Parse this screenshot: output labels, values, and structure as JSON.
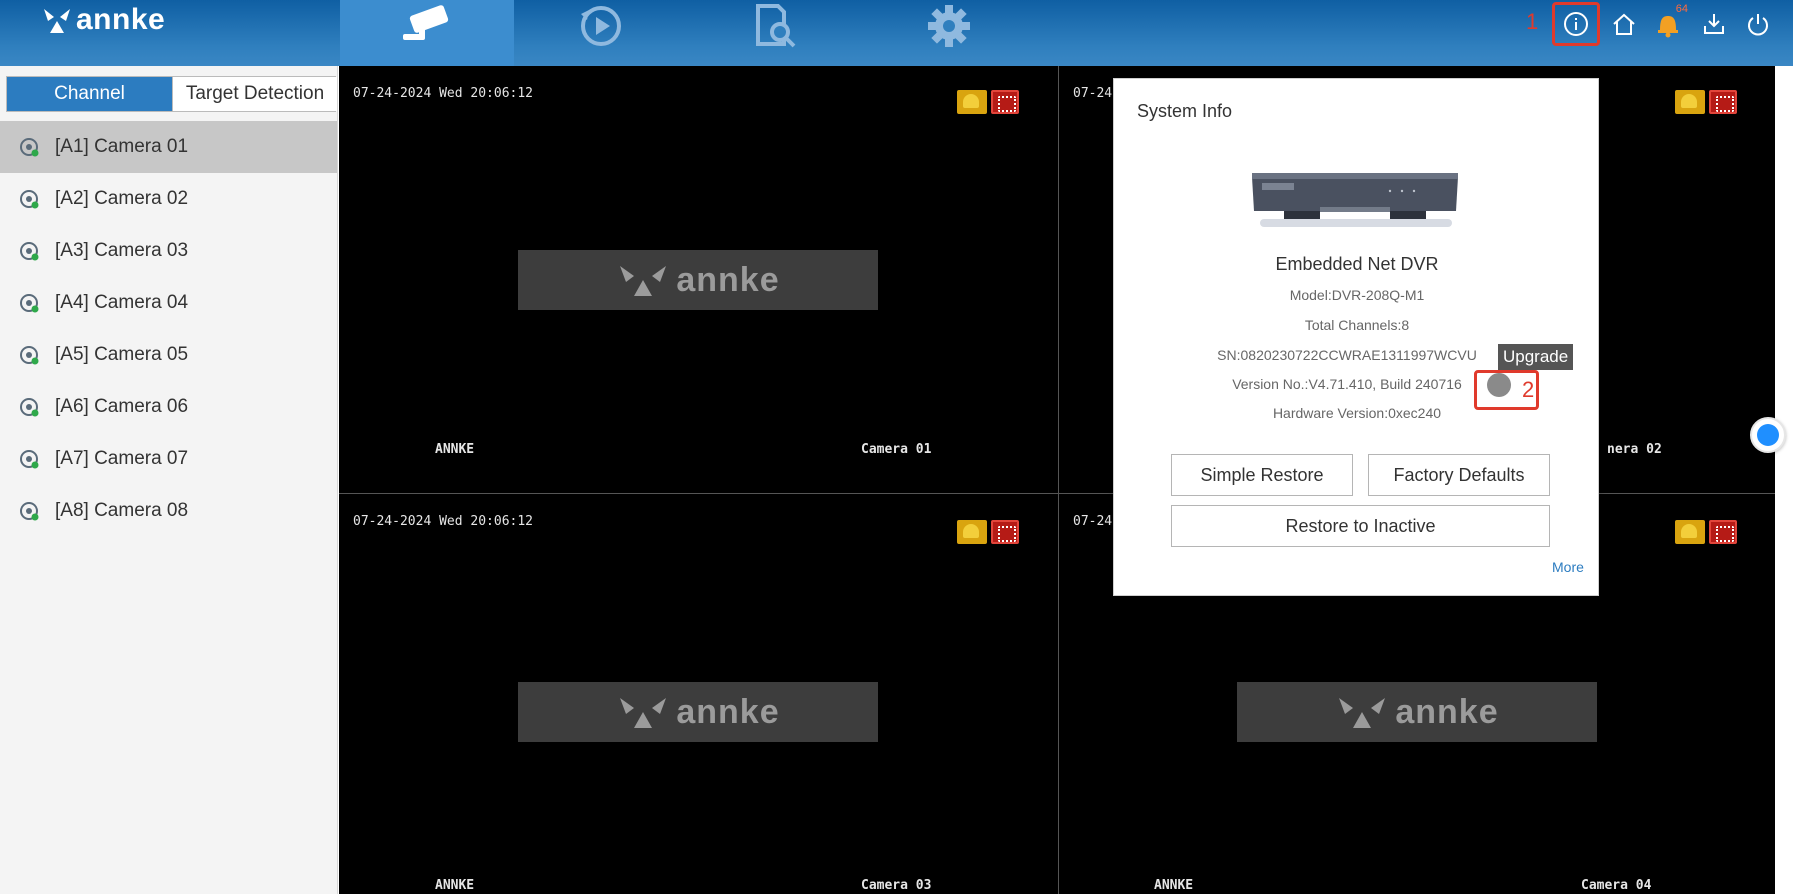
{
  "brand": {
    "logo_text": "annke"
  },
  "top_nav": {
    "tabs": [
      {
        "name": "live-view",
        "icon": "cctv-camera-icon",
        "active": true
      },
      {
        "name": "playback",
        "icon": "playback-icon",
        "active": false
      },
      {
        "name": "search",
        "icon": "file-search-icon",
        "active": false
      },
      {
        "name": "configuration",
        "icon": "gear-icon",
        "active": false
      }
    ],
    "tools": {
      "info_icon": "info-icon",
      "home_icon": "home-icon",
      "bell_icon": "bell-icon",
      "bell_count": "64",
      "download_icon": "download-icon",
      "power_icon": "power-icon"
    },
    "step_label_1": "1"
  },
  "sidebar": {
    "tabs": [
      "Channel",
      "Target Detection"
    ],
    "cameras": [
      "[A1] Camera 01",
      "[A2] Camera 02",
      "[A3] Camera 03",
      "[A4] Camera 04",
      "[A5] Camera 05",
      "[A6] Camera 06",
      "[A7] Camera 07",
      "[A8] Camera 08"
    ],
    "selected_index": 0
  },
  "grid": {
    "cells": [
      {
        "timestamp": "07-24-2024 Wed 20:06:12",
        "brand_osd": "ANNKE",
        "camera_osd": "Camera 01"
      },
      {
        "timestamp": "07-24",
        "brand_osd": "",
        "camera_osd": "nera 02"
      },
      {
        "timestamp": "07-24-2024 Wed 20:06:12",
        "brand_osd": "ANNKE",
        "camera_osd": "Camera 03"
      },
      {
        "timestamp": "07-24",
        "brand_osd": "ANNKE",
        "camera_osd": "Camera 04"
      }
    ],
    "placeholder_text": "annke"
  },
  "system_info": {
    "title": "System Info",
    "product": "Embedded Net DVR",
    "model": "Model:DVR-208Q-M1",
    "total_channels": "Total Channels:8",
    "sn": "SN:0820230722CCWRAE1311997WCVU",
    "version": "Version No.:V4.71.410, Build 240716",
    "hardware": "Hardware Version:0xec240",
    "tooltip": "Upgrade",
    "step_label_2": "2",
    "buttons": {
      "simple_restore": "Simple Restore",
      "factory_defaults": "Factory Defaults",
      "restore_inactive": "Restore to Inactive"
    },
    "more": "More"
  },
  "colors": {
    "topbar": "#2f7fbe",
    "active_tab": "#2c7cc0",
    "highlight_frame": "#e03a2c",
    "link": "#2c7cc0"
  }
}
